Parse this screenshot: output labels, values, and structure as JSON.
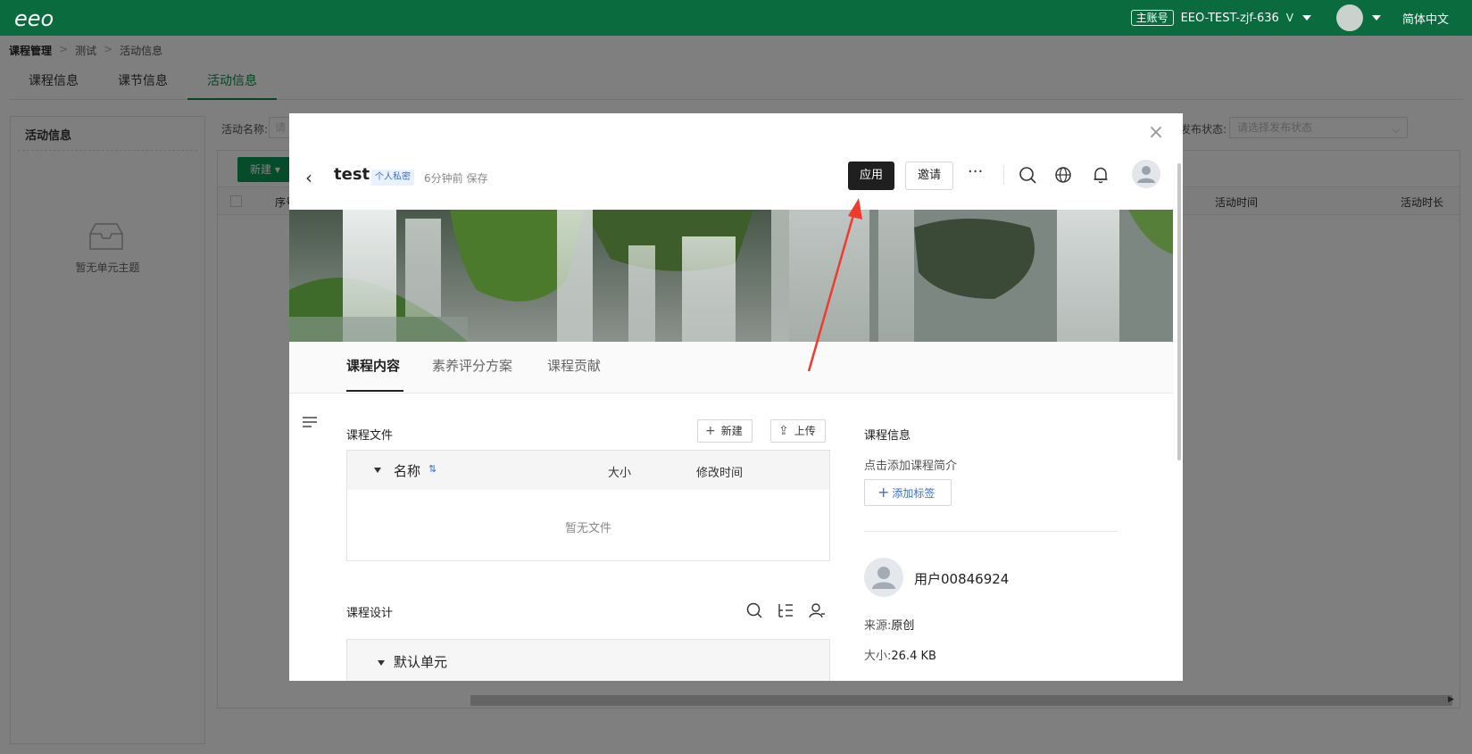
{
  "colors": {
    "brand_green": "#0a6b3f",
    "accent_green": "#0a8a4a",
    "apply_dark": "#1f1f1f",
    "link_blue": "#3b6fd6",
    "annotation_red": "#f03a2e"
  },
  "topbar": {
    "logo_text": "eeo",
    "account_badge": "主账号",
    "account_name": "EEO-TEST-zjf-636",
    "account_level": "V",
    "language": "简体中文"
  },
  "breadcrumb": {
    "items": [
      "课程管理",
      "测试",
      "活动信息"
    ],
    "separator": ">"
  },
  "subtabs": [
    "课程信息",
    "课节信息",
    "活动信息"
  ],
  "left_panel": {
    "title": "活动信息",
    "empty_text": "暂无单元主题"
  },
  "filters": {
    "activity_name_label": "活动名称:",
    "activity_name_placeholder": "请",
    "publish_status_label": "发布状态:",
    "publish_status_placeholder": "请选择发布状态"
  },
  "bg_table": {
    "new_button": "新建",
    "columns": [
      "序号",
      "活动时间",
      "活动时长"
    ]
  },
  "modal": {
    "title": "test",
    "private_tag": "个人私密",
    "saved_status": "6分钟前 保存",
    "apply_button": "应用",
    "invite_button": "邀请",
    "more_icon": "ellipsis-icon",
    "toolbar_icons": [
      "search-icon",
      "globe-icon",
      "bell-icon",
      "avatar-icon"
    ],
    "content_tabs": [
      "课程内容",
      "素养评分方案",
      "课程贡献"
    ],
    "files": {
      "section_title": "课程文件",
      "new_button": "新建",
      "upload_button": "上传",
      "columns": {
        "name": "名称",
        "size": "大小",
        "modified": "修改时间"
      },
      "empty_text": "暂无文件"
    },
    "design": {
      "section_title": "课程设计",
      "icons": [
        "search-icon",
        "outline-list-icon",
        "user-manage-icon"
      ],
      "default_unit": "默认单元"
    },
    "course_info": {
      "title": "课程信息",
      "description_placeholder": "点击添加课程简介",
      "add_tag_button": "添加标签",
      "user_name": "用户00846924",
      "source_label": "来源:",
      "source_value": "原创",
      "size_label": "大小:",
      "size_value": "26.4 KB"
    }
  }
}
